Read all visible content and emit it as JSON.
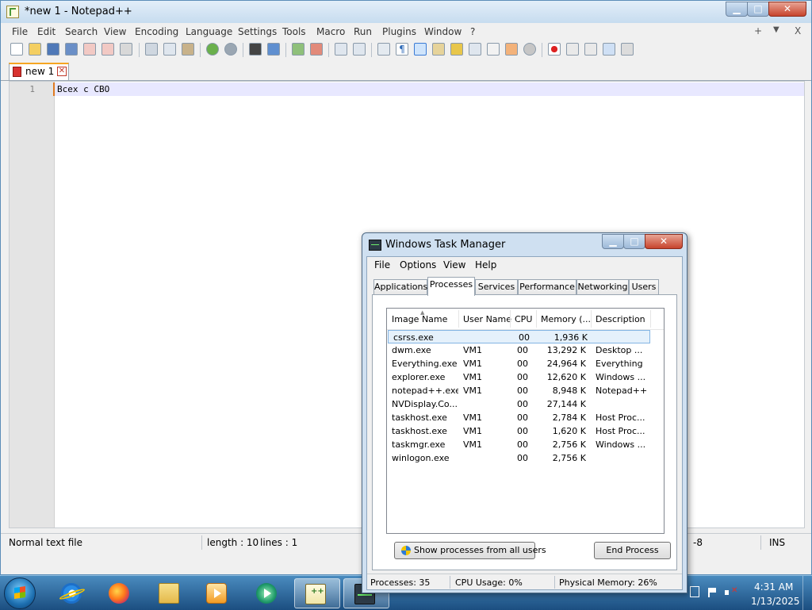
{
  "notepad": {
    "title": "*new 1 - Notepad++",
    "menu": [
      "File",
      "Edit",
      "Search",
      "View",
      "Encoding",
      "Language",
      "Settings",
      "Tools",
      "Macro",
      "Run",
      "Plugins",
      "Window",
      "?"
    ],
    "menu_right": {
      "add": "+",
      "dropdown": "▼",
      "close": "X"
    },
    "tab_label": "new 1",
    "line_number": "1",
    "line_text": "Всех с СВО",
    "status": {
      "file_type": "Normal text file",
      "length": "length : 10",
      "lines": "lines : 1",
      "encoding_partial": "-8",
      "mode": "INS"
    }
  },
  "task_manager": {
    "title": "Windows Task Manager",
    "menu": [
      "File",
      "Options",
      "View",
      "Help"
    ],
    "tabs": [
      "Applications",
      "Processes",
      "Services",
      "Performance",
      "Networking",
      "Users"
    ],
    "active_tab": "Processes",
    "columns": [
      "Image Name",
      "User Name",
      "CPU",
      "Memory (...",
      "Description"
    ],
    "rows": [
      {
        "name": "csrss.exe",
        "user": "",
        "cpu": "00",
        "memory": "1,936 K",
        "description": ""
      },
      {
        "name": "dwm.exe",
        "user": "VM1",
        "cpu": "00",
        "memory": "13,292 K",
        "description": "Desktop ..."
      },
      {
        "name": "Everything.exe",
        "user": "VM1",
        "cpu": "00",
        "memory": "24,964 K",
        "description": "Everything"
      },
      {
        "name": "explorer.exe",
        "user": "VM1",
        "cpu": "00",
        "memory": "12,620 K",
        "description": "Windows ..."
      },
      {
        "name": "notepad++.exe",
        "user": "VM1",
        "cpu": "00",
        "memory": "8,948 K",
        "description": "Notepad++"
      },
      {
        "name": "NVDisplay.Co...",
        "user": "",
        "cpu": "00",
        "memory": "27,144 K",
        "description": ""
      },
      {
        "name": "taskhost.exe",
        "user": "VM1",
        "cpu": "00",
        "memory": "2,784 K",
        "description": "Host Proc..."
      },
      {
        "name": "taskhost.exe",
        "user": "VM1",
        "cpu": "00",
        "memory": "1,620 K",
        "description": "Host Proc..."
      },
      {
        "name": "taskmgr.exe",
        "user": "VM1",
        "cpu": "00",
        "memory": "2,756 K",
        "description": "Windows ..."
      },
      {
        "name": "winlogon.exe",
        "user": "",
        "cpu": "00",
        "memory": "2,756 K",
        "description": ""
      }
    ],
    "selected_row": 0,
    "buttons": {
      "show_all": "Show processes from all users",
      "end_process": "End Process"
    },
    "status": {
      "processes": "Processes: 35",
      "cpu": "CPU Usage: 0%",
      "memory": "Physical Memory: 26%"
    }
  },
  "taskbar": {
    "time": "4:31 AM",
    "date": "1/13/2025",
    "pinned": [
      "internet-explorer-icon",
      "firefox-icon",
      "folder-icon",
      "media-center-icon",
      "media-player-icon",
      "notepad-plus-plus-icon",
      "task-manager-icon"
    ]
  },
  "colors": {
    "caption_close": "#c7442d",
    "current_line": "#e8e8ff",
    "tab_accent": "#f5a623",
    "taskbar": "#1b4e80"
  }
}
